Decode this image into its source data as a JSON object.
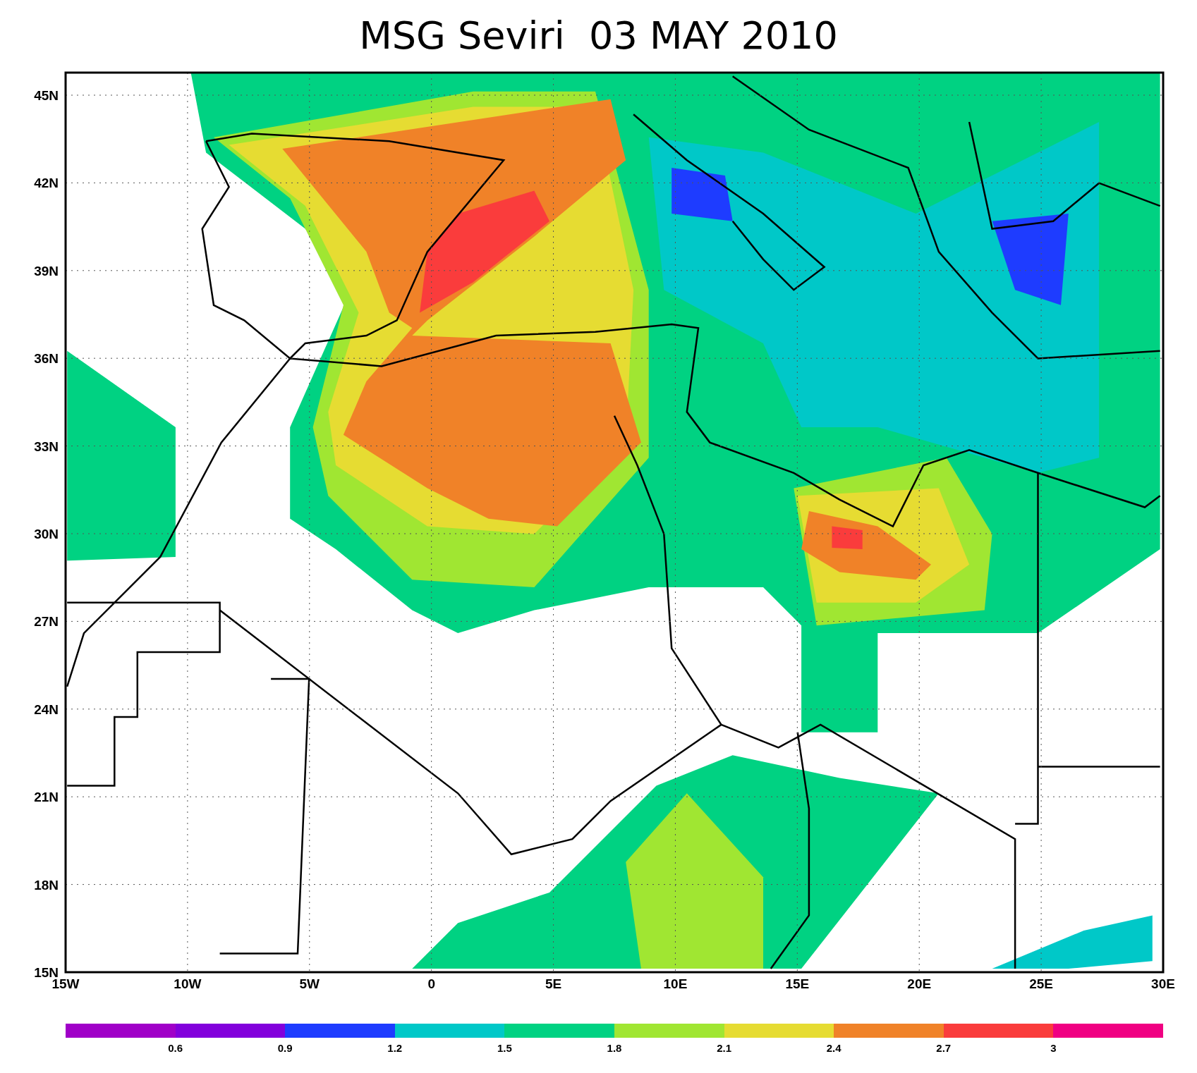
{
  "title": "MSG Seviri  03 MAY 2010",
  "map": {
    "y_ticks": [
      "45N",
      "42N",
      "39N",
      "36N",
      "33N",
      "30N",
      "27N",
      "24N",
      "21N",
      "18N",
      "15N"
    ],
    "x_ticks": [
      "15W",
      "10W",
      "5W",
      "0",
      "5E",
      "10E",
      "15E",
      "20E",
      "25E",
      "30E"
    ]
  },
  "colorbar": {
    "segments": [
      {
        "color": "#a000c8"
      },
      {
        "color": "#8200dc"
      },
      {
        "color": "#1e3cff"
      },
      {
        "color": "#00c8c8"
      },
      {
        "color": "#00d282"
      },
      {
        "color": "#a0e632"
      },
      {
        "color": "#e6dc32"
      },
      {
        "color": "#f08228"
      },
      {
        "color": "#fa3c3c"
      },
      {
        "color": "#f00082"
      }
    ],
    "labels": [
      "0.6",
      "0.9",
      "1.2",
      "1.5",
      "1.8",
      "2.1",
      "2.4",
      "2.7",
      "3"
    ]
  }
}
